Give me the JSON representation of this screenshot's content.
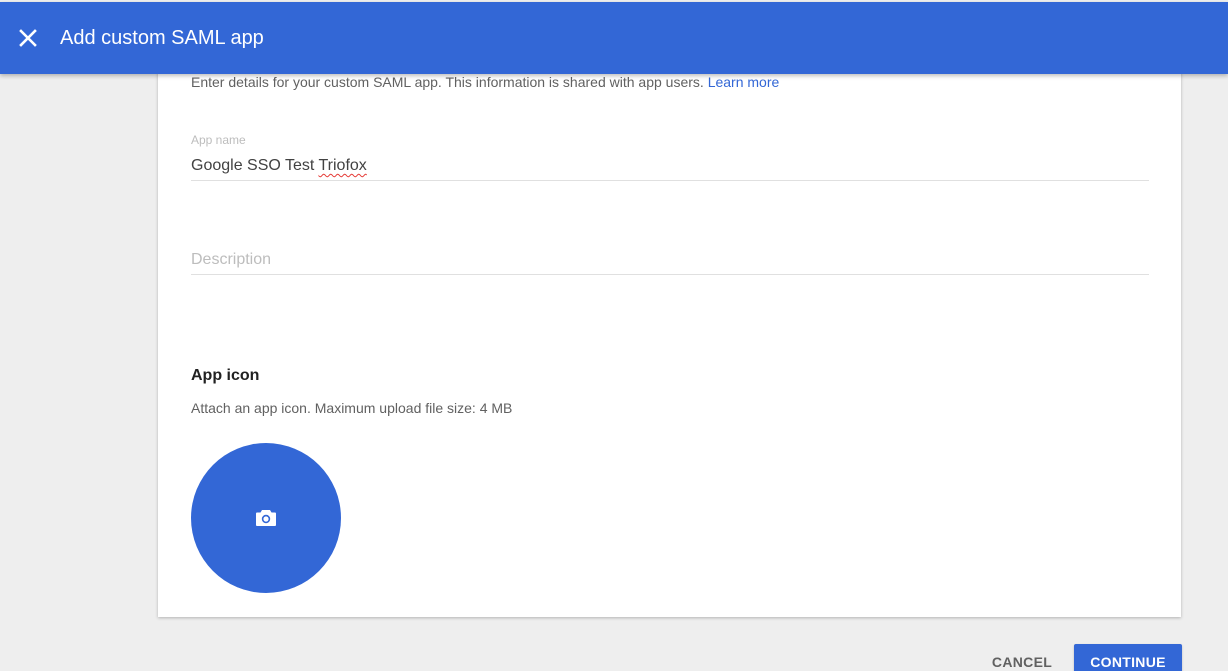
{
  "header": {
    "title": "Add custom SAML app",
    "close_icon": "close-icon"
  },
  "intro": {
    "text": "Enter details for your custom SAML app. This information is shared with app users.",
    "link_label": "Learn more"
  },
  "form": {
    "app_name": {
      "label": "App name",
      "value_prefix": "Google SSO Test ",
      "value_misspelled": "Triofox"
    },
    "description": {
      "placeholder": "Description"
    }
  },
  "app_icon": {
    "title": "App icon",
    "description": "Attach an app icon. Maximum upload file size: 4 MB",
    "upload_icon": "camera-icon"
  },
  "footer": {
    "cancel_label": "CANCEL",
    "continue_label": "CONTINUE"
  },
  "colors": {
    "primary": "#3367d6",
    "background": "#eeeeee",
    "card": "#ffffff"
  }
}
